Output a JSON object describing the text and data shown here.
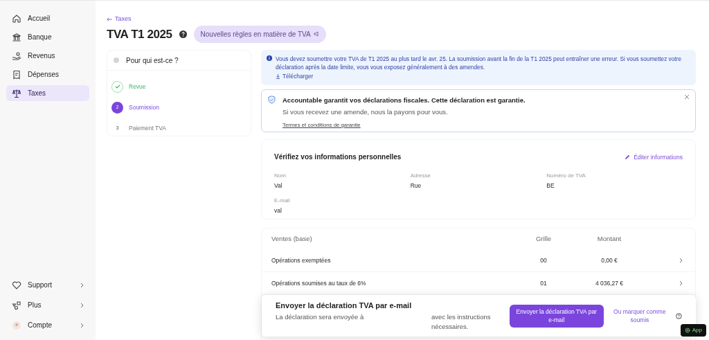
{
  "sidebar": {
    "items": [
      {
        "kind": "home",
        "label": "Accueil",
        "selected": false
      },
      {
        "kind": "bank",
        "label": "Banque",
        "selected": false
      },
      {
        "kind": "income",
        "label": "Revenus",
        "selected": false
      },
      {
        "kind": "receipt",
        "label": "Dépenses",
        "selected": false
      },
      {
        "kind": "scale",
        "label": "Taxes",
        "selected": true
      }
    ],
    "bottom_items": [
      {
        "kind": "heart",
        "label": "Support"
      },
      {
        "kind": "shapes",
        "label": "Plus"
      },
      {
        "kind": "avatar",
        "label": "Compte"
      }
    ]
  },
  "header": {
    "back_link": "Taxes",
    "title": "TVA T1 2025",
    "badge": "Nouvelles règles en matière de TVA"
  },
  "stepper": {
    "question": "Pour qui est-ce ?",
    "steps": [
      {
        "label": "Revue",
        "kind": "done"
      },
      {
        "number": "2",
        "label": "Soumission",
        "kind": "current"
      },
      {
        "number": "3",
        "label": "Paiement TVA",
        "kind": "todo"
      }
    ]
  },
  "info_banner": {
    "text": "Vous devez soumettre votre TVA de T1 2025 au plus tard le avr. 25. La soumission avant la fin de la T1 2025 peut entraîner une erreur. Si vous soumettez votre déclaration après la date limite, vous vous exposez généralement à des amendes.",
    "link": "Télécharger"
  },
  "guarantee": {
    "title": "Accountable garantit vos déclarations fiscales. Cette déclaration est garantie.",
    "text": "Si vous recevez une amende, nous la payons pour vous.",
    "link": "Termes et conditions de garantie"
  },
  "personal_info": {
    "title": "Vérifiez vos informations personnelles",
    "edit": "Éditer informations",
    "fields": [
      {
        "label": "Nom",
        "value": "Val"
      },
      {
        "label": "Adresse",
        "value": "Rue"
      },
      {
        "label": "Numéro de TVA",
        "value": "BE"
      },
      {
        "label": "E-mail",
        "value": "val"
      }
    ]
  },
  "table": {
    "columns": [
      "Ventes (base)",
      "Grille",
      "Montant"
    ],
    "rows": [
      {
        "name": "Opérations exemptées",
        "grid": "00",
        "amount": "0,00 €"
      },
      {
        "name": "Opérations soumises au taux de 6%",
        "grid": "01",
        "amount": "4 036,27 €"
      }
    ]
  },
  "send_bar": {
    "title": "Envoyer la déclaration TVA par e-mail",
    "text_start": "La déclaration sera envoyée à",
    "text_end": "avec les instructions nécessaires.",
    "button": "Envoyer la déclaration TVA par e-mail",
    "link": "Ou marquer comme soumis"
  },
  "app_button": "App"
}
